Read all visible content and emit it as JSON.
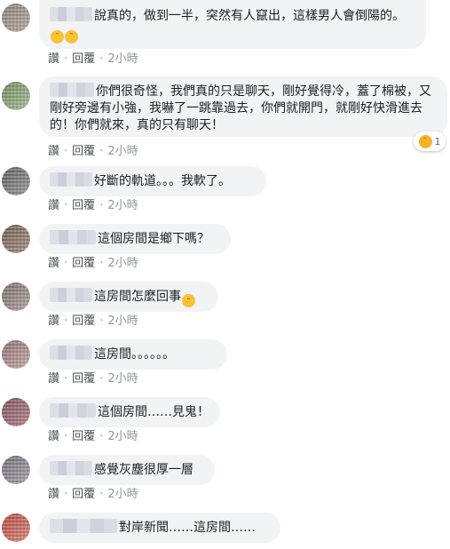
{
  "comments": [
    {
      "text": "說真的，做到一半，突然有人竄出，這樣男人會倒陽的。",
      "like": "讚",
      "reply": "回覆",
      "time": "2小時"
    },
    {
      "text": "你們很奇怪，我們真的只是聊天，剛好覺得冷，蓋了棉被，又剛好旁邊有小強，我嚇了一跳靠過去，你們就開門，就剛好快滑進去的！你們就來，真的只有聊天！",
      "like": "讚",
      "reply": "回覆",
      "time": "2小時",
      "reaction_count": "1"
    },
    {
      "text": "好斷的軌道。。。我軟了。",
      "like": "讚",
      "reply": "回覆",
      "time": "2小時"
    },
    {
      "text": "這個房間是鄉下嗎？",
      "like": "讚",
      "reply": "回覆",
      "time": "2小時"
    },
    {
      "text": "這房間怎麼回事",
      "like": "讚",
      "reply": "回覆",
      "time": "2小時"
    },
    {
      "text": "這房間。。。。。。",
      "like": "讚",
      "reply": "回覆",
      "time": "2小時"
    },
    {
      "text": "這個房間……見鬼！",
      "like": "讚",
      "reply": "回覆",
      "time": "2小時"
    },
    {
      "text": "感覺灰塵很厚一層",
      "like": "讚",
      "reply": "回覆",
      "time": "2小時"
    },
    {
      "text": "對岸新聞……這房間……"
    }
  ],
  "colors": {
    "bubble": "#f2f3f5",
    "meta": "#606770",
    "emoji": "#f7c234"
  },
  "icons": {
    "laugh": "grinning-squinting-face-icon",
    "smile": "smiling-face-icon",
    "reaction": "haha-reaction-icon"
  }
}
